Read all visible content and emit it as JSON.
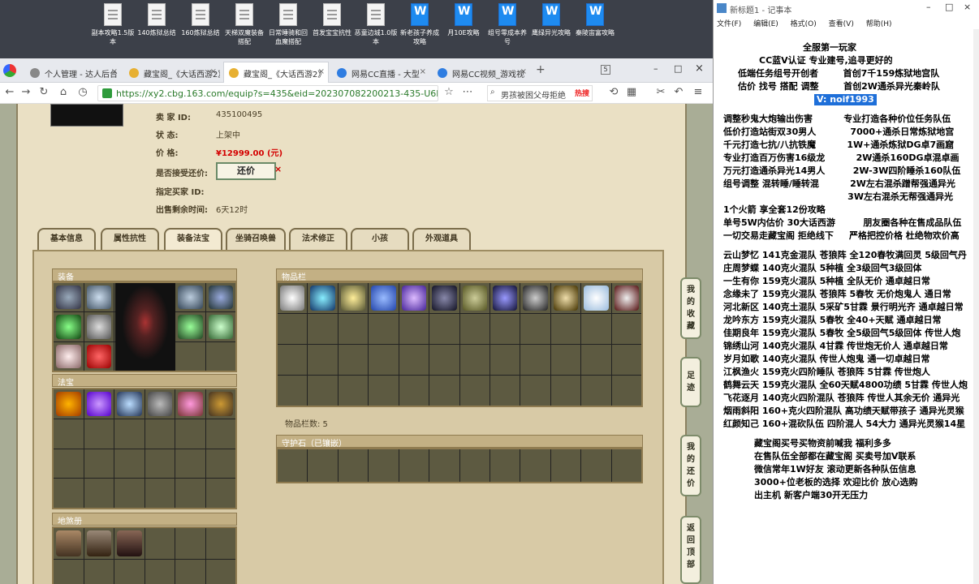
{
  "desktop": {
    "icons": [
      {
        "label": "副本攻略1.5版本",
        "type": "doc"
      },
      {
        "label": "140炼狱总结",
        "type": "doc"
      },
      {
        "label": "160炼狱总结",
        "type": "doc"
      },
      {
        "label": "天梯双魔装备搭配",
        "type": "doc"
      },
      {
        "label": "日常睡骑和回血魔搭配",
        "type": "doc"
      },
      {
        "label": "首发宝宝抗性",
        "type": "doc"
      },
      {
        "label": "恶童边城1.0版本",
        "type": "doc"
      },
      {
        "label": "新老孩子养成攻略",
        "type": "word"
      },
      {
        "label": "月10E攻略",
        "type": "word"
      },
      {
        "label": "组号零成本养号",
        "type": "word"
      },
      {
        "label": "鹰绿异光攻略",
        "type": "word"
      },
      {
        "label": "秦陵宙富攻略",
        "type": "word"
      }
    ]
  },
  "browser": {
    "tabs": [
      {
        "label": "个人管理 - 达人后台"
      },
      {
        "label": "藏宝阁_《大话西游2》"
      },
      {
        "label": "藏宝阁_《大话西游2》"
      },
      {
        "label": "网易CC直播 - 大型"
      },
      {
        "label": "网易CC视频_游戏视"
      }
    ],
    "tab_count": "5",
    "url": "https://xy2.cbg.163.com/equip?s=435&eid=202307082200213-435-U6RCZ2RF1E5D",
    "search_placeholder": "男孩被困父母拒绝",
    "hot_label": "热搜"
  },
  "listing": {
    "seller_label": "卖 家 ID:",
    "seller_value": "435100495",
    "status_label": "状 态:",
    "status_value": "上架中",
    "price_label": "价 格:",
    "price_value": "¥12999.00 (元)",
    "bargain_label": "是否接受还价:",
    "bargain_button": "还价",
    "buyer_label": "指定买家 ID:",
    "time_label": "出售剩余时间:",
    "time_value": "6天12时"
  },
  "game_tabs": [
    "基本信息",
    "属性抗性",
    "装备法宝",
    "坐骑召唤兽",
    "法术修正",
    "小孩",
    "外观道具"
  ],
  "sections": {
    "equipment": "装备",
    "treasure": "法宝",
    "ground": "地煞册",
    "items": "物品栏",
    "item_count": "物品栏数: 5",
    "guard_stone": "守护石（已镶嵌）"
  },
  "side_tabs": [
    "我的收藏",
    "足迹",
    "我的还价",
    "返回顶部"
  ],
  "notepad": {
    "title": "新标题1 - 记事本",
    "menu": [
      "文件(F)",
      "编辑(E)",
      "格式(O)",
      "查看(V)",
      "帮助(H)"
    ],
    "lines": [
      "全服第一玩家",
      "CC蓝V认证 专业建号,追寻更好的",
      "低端任务组号开创者        首创7千159炼狱地宫队",
      "估价 找号 搭配 调整        首创2W通杀异光秦岭队",
      "V: noif1993",
      "",
      "调整秒鬼大炮输出伤害          专业打造各种价位任务队伍",
      "低价打造站街双30男人           7000+通杀日常炼狱地宫",
      "千元打造七抗/八抗铁魔          1W+通杀炼狱DG卓7画窟",
      "专业打造百万伤害16级龙          2W通杀160DG卓混卓画",
      "万元打造通杀异光14男人         2W-3W四阶睡杀160队伍",
      "组号调整 混转睡/睡转混          2W左右混杀蹭帮强通异光",
      "                                        3W左右混杀无帮强通异光",
      "1个火箭 享全套12份攻略",
      "单号5W内估价 30大话西游         朋友圈各种在售成品队伍",
      "一切交易走藏宝阁 拒绝线下     严格把控价格 杜绝物欢价高",
      "",
      "云山梦忆 141克金混队 苍狼阵 全120春牧满回灵 5级回气丹",
      "庄周梦蝶 140克火混队 5种植 全3级回气3级回体",
      "一生有你 159克火混队 5种植 全队无价 通卓越日常",
      "念缘未了 159克火混队 苍狼阵 5春牧 无价炮鬼人 通日常",
      "河北新区 140克土混队 5采矿5甘霖 景行明光齐 通卓越日常",
      "龙吟东方 159克火混队 5春牧 全40+天赋 通卓越日常",
      "佳期良年 159克火混队 5春牧 全5级回气5级回体 传世人炮",
      "锦绣山河 140克火混队 4甘霖 传世炮无价人 通卓越日常",
      "岁月如歌 140克火混队 传世人炮鬼 通一切卓越日常",
      "江枫渔火 159克火四阶睡队 苍狼阵 5甘霖 传世炮人",
      "鹤舞云天 159克火混队 全60天赋4800功绩 5甘霖 传世人炮",
      "飞花逐月 140克火四阶混队 苍狼阵 传世人其余无价 通异光",
      "烟雨斜阳 160+克火四阶混队 高功绩天赋带孩子 通异光灵猴",
      "红颜知己 160+混砍队伍 四阶混人 54大力 通异光灵猴14星",
      "",
      "藏宝阁买号买物资前喊我 福利多多",
      "在售队伍全部都在藏宝阁 买卖号加V联系",
      "微信常年1W好友 滚动更新各种队伍信息",
      "3000+位老板的选择 欢迎比价 放心选购",
      "出主机 新客户端30开无压力"
    ]
  },
  "colors": {
    "paper": "#eae0c4",
    "price": "#d40000",
    "panel": "#d8caa6",
    "cell": "#5d5a41",
    "highlight": "#1e6fd9"
  },
  "equipment_icons": [
    "armor-icon",
    "necklace-icon",
    "character-model",
    "gem-icon",
    "helmet-icon",
    "sword-icon",
    "glove-icon",
    "shield-icon",
    "ring-icon",
    "bracer-icon",
    "boots-icon",
    "belt-icon",
    "orb-icon"
  ],
  "treasure_icons": [
    "fire-orb-icon",
    "scroll-icon",
    "wand-icon",
    "whip-icon",
    "bottle-icon",
    "hammer-icon"
  ],
  "item_icons": [
    "medal-icon",
    "vortex-icon",
    "coin-icon",
    "wing-icon",
    "statue-icon",
    "blackorb-icon",
    "vase-icon",
    "spirit-icon",
    "chain-icon",
    "orb-ring-icon",
    "white-orb-icon",
    "dagger-icon"
  ]
}
